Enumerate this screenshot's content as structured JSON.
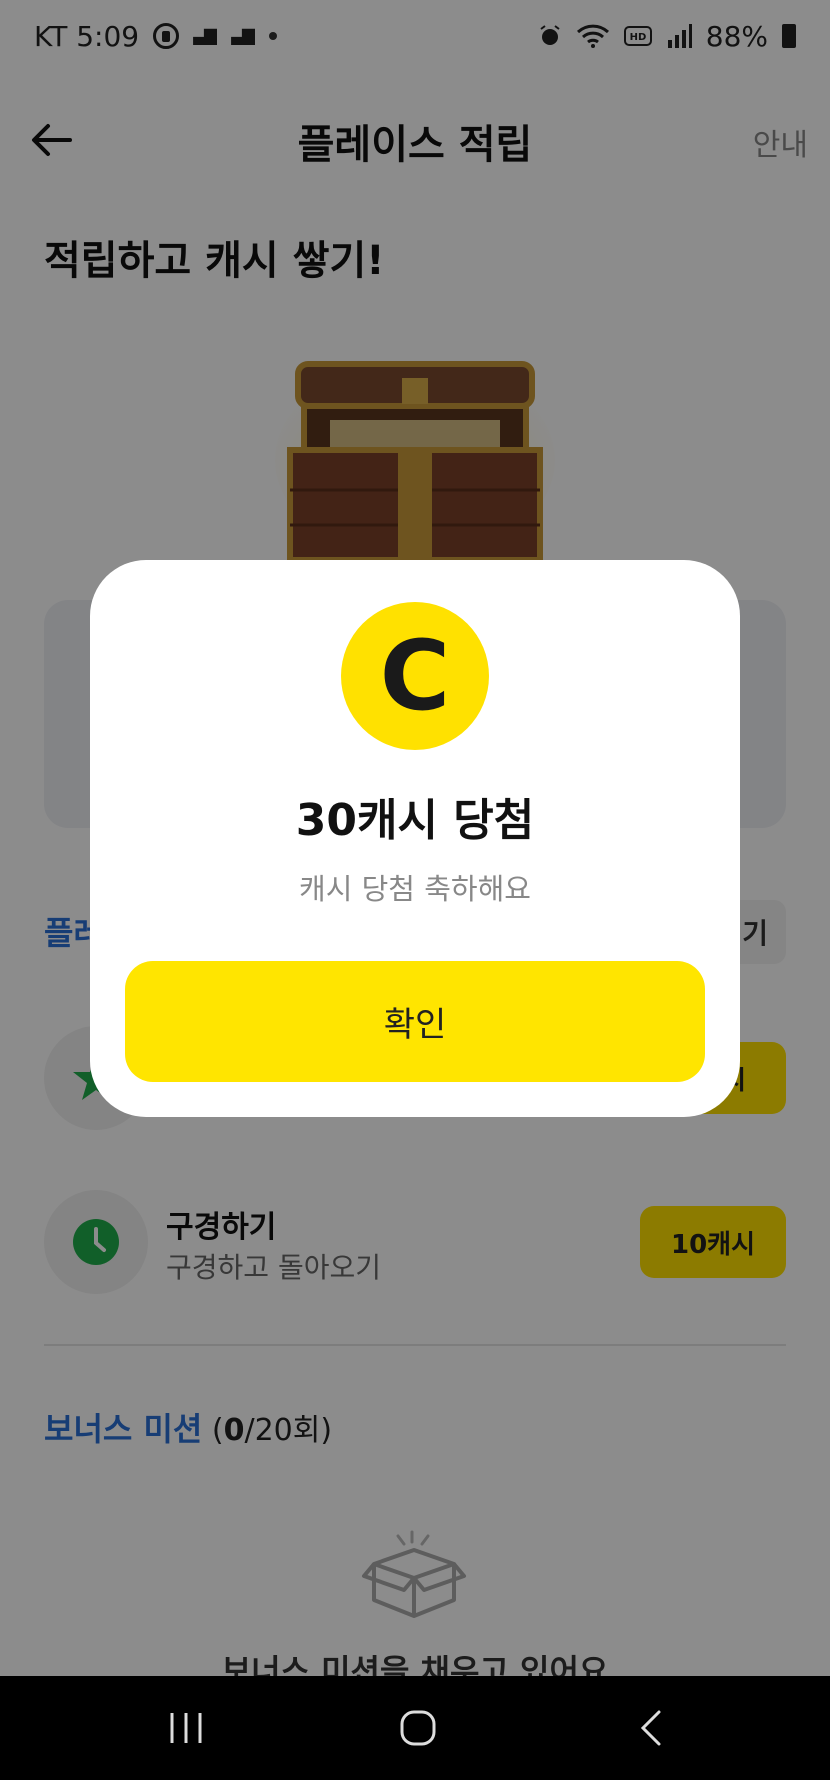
{
  "status_bar": {
    "carrier_time": "KT 5:09",
    "battery": "88%",
    "icons": [
      "record-icon",
      "step-icon",
      "step-icon",
      "dot-icon",
      "alarm-icon",
      "wifi-icon",
      "hd-icon",
      "signal-icon",
      "battery-icon"
    ]
  },
  "header": {
    "title": "플레이스 적립",
    "guide_label": "안내",
    "back_icon": "arrow-left-icon"
  },
  "hero": {
    "title": "적립하고 캐시 쌓기!",
    "image": "treasure-chest"
  },
  "missions_section": {
    "title_partial": "플레",
    "button_partial": "기"
  },
  "missions": [
    {
      "title": "",
      "subtitle": "",
      "reward": "시",
      "icon": "star-icon"
    },
    {
      "title": "구경하기",
      "subtitle": "구경하고 돌아오기",
      "reward": "10캐시",
      "icon": "clock-icon"
    }
  ],
  "bonus": {
    "label": "보너스 미션",
    "open_paren": " (",
    "count_current": "0",
    "count_total": "/20회)",
    "empty_text": "보너스 미션을 채우고 있어요",
    "icon": "box-icon"
  },
  "modal": {
    "coin_letter": "C",
    "title": "30캐시 당첨",
    "subtitle": "캐시 당첨 축하해요",
    "confirm_label": "확인"
  },
  "nav_bar": {
    "buttons": [
      "recent-apps-icon",
      "home-icon",
      "back-icon"
    ]
  },
  "colors": {
    "accent_yellow": "#ffe500",
    "link_blue": "#2a6fd6",
    "overlay": "rgba(0,0,0,0.45)"
  }
}
